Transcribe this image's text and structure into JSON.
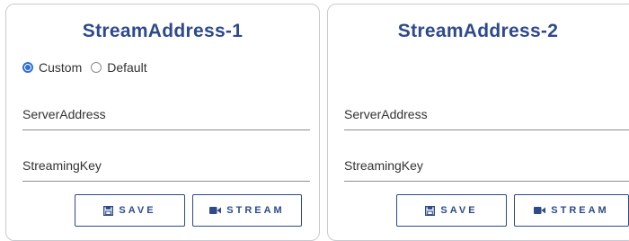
{
  "cards": [
    {
      "title": "StreamAddress-1",
      "radios": [
        {
          "label": "Custom",
          "checked": true
        },
        {
          "label": "Default",
          "checked": false
        }
      ],
      "server_label": "ServerAddress",
      "key_label": "StreamingKey",
      "save_label": "SAVE",
      "stream_label": "STREAM"
    },
    {
      "title": "StreamAddress-2",
      "server_label": "ServerAddress",
      "key_label": "StreamingKey",
      "save_label": "SAVE",
      "stream_label": "STREAM"
    }
  ],
  "icons": {
    "save": "floppy-disk-icon",
    "stream": "video-camera-icon"
  },
  "colors": {
    "title": "#2e4a8c",
    "button_border": "#2e4a8c",
    "radio_checked": "#2f6fd8",
    "card_border": "#c9c9d1"
  }
}
